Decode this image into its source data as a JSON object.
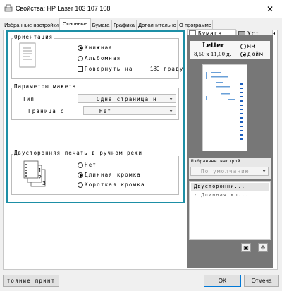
{
  "window": {
    "title": "Свойства: HP Laser 103 107 108",
    "close_glyph": "✕"
  },
  "tabs": [
    "Избранные настройки",
    "Основные",
    "Бумага",
    "Графика",
    "Дополнительно",
    "О программе"
  ],
  "orientation": {
    "title": "Ориентация",
    "portrait": "Книжная",
    "landscape": "Альбомная",
    "rotate": "Повернуть на",
    "rotate_value": "180",
    "rotate_suffix": "граду"
  },
  "layout": {
    "title": "Параметры макета",
    "type_label": "Тип",
    "type_value": "Одна страница н",
    "border_label": "Граница с",
    "border_value": "Нет"
  },
  "duplex": {
    "title": "Двусторонняя печать в ручном режи",
    "none": "Нет",
    "long": "Длинная кромка",
    "short": "Короткая кромка"
  },
  "preview": {
    "tab_paper": "Бумага",
    "tab_other": "Уст",
    "paper_name": "Letter",
    "paper_size": "8,50 x 11,00 д.",
    "unit_mm": "мм",
    "unit_in": "дюйм",
    "favorites_title": "Избранные настрой",
    "favorites_value": "По умолчанию",
    "summary_1": "Двусторонни...",
    "summary_2": "- Длинная кр..."
  },
  "footer": {
    "status_button": "тояние принт",
    "ok": "OK",
    "cancel": "Отмена"
  }
}
